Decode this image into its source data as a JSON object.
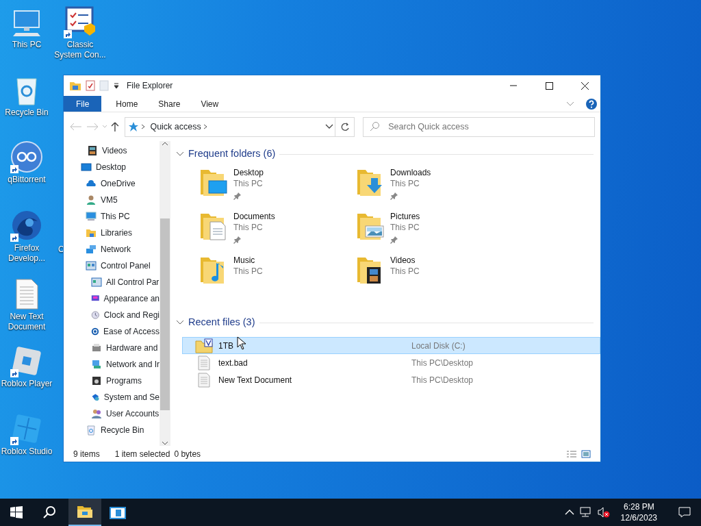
{
  "desktop_icons": [
    {
      "label": "This PC",
      "shortcut": false
    },
    {
      "label": "Classic System Con...",
      "shortcut": true
    },
    {
      "label": "Recycle Bin",
      "shortcut": false
    },
    {
      "label": "qBittorrent",
      "shortcut": true
    },
    {
      "label": "Firefox Develop...",
      "shortcut": true
    },
    {
      "label": "New Text Document",
      "shortcut": false
    },
    {
      "label": "Roblox Player",
      "shortcut": true
    },
    {
      "label": "Roblox Studio",
      "shortcut": true
    }
  ],
  "desktop_partial_label": "C",
  "window": {
    "title": "File Explorer",
    "ribbon_tabs": [
      {
        "label": "File",
        "kind": "menu"
      },
      {
        "label": "Home",
        "kind": "tab"
      },
      {
        "label": "Share",
        "kind": "tab"
      },
      {
        "label": "View",
        "kind": "tab"
      }
    ],
    "address": {
      "path": "Quick access"
    },
    "search": {
      "placeholder": "Search Quick access"
    },
    "nav": [
      {
        "label": "Videos"
      },
      {
        "label": "Desktop",
        "children": [
          {
            "label": "OneDrive"
          },
          {
            "label": "VM5"
          },
          {
            "label": "This PC"
          },
          {
            "label": "Libraries"
          },
          {
            "label": "Network"
          },
          {
            "label": "Control Panel",
            "children": [
              {
                "label": "All Control Par"
              },
              {
                "label": "Appearance an"
              },
              {
                "label": "Clock and Regi"
              },
              {
                "label": "Ease of Access"
              },
              {
                "label": "Hardware and"
              },
              {
                "label": "Network and Ir"
              },
              {
                "label": "Programs"
              },
              {
                "label": "System and Se"
              },
              {
                "label": "User Accounts"
              }
            ]
          },
          {
            "label": "Recycle Bin"
          }
        ]
      }
    ],
    "frequent": {
      "title": "Frequent folders (6)",
      "expanded": true,
      "folders": [
        {
          "name": "Desktop",
          "location": "This PC",
          "pinned": true
        },
        {
          "name": "Downloads",
          "location": "This PC",
          "pinned": true
        },
        {
          "name": "Documents",
          "location": "This PC",
          "pinned": true
        },
        {
          "name": "Pictures",
          "location": "This PC",
          "pinned": true
        },
        {
          "name": "Music",
          "location": "This PC",
          "pinned": false
        },
        {
          "name": "Videos",
          "location": "This PC",
          "pinned": false
        }
      ]
    },
    "recent": {
      "title": "Recent files (3)",
      "expanded": true,
      "files": [
        {
          "name": "1TB",
          "location": "Local Disk (C:)",
          "selected": true
        },
        {
          "name": "text.bad",
          "location": "This PC\\Desktop",
          "selected": false
        },
        {
          "name": "New Text Document",
          "location": "This PC\\Desktop",
          "selected": false
        }
      ]
    },
    "status_bar": {
      "items": "9 items",
      "selection": "1 item selected",
      "size": "0 bytes"
    }
  },
  "taskbar": {
    "apps": [
      {
        "active": true
      },
      {
        "active": false
      }
    ],
    "time": "6:28 PM",
    "date": "12/6/2023"
  }
}
